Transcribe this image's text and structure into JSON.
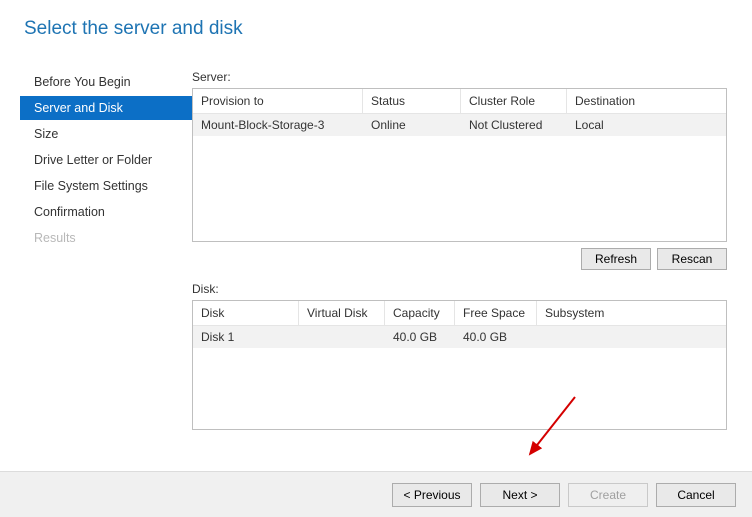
{
  "title": "Select the server and disk",
  "sidebar": {
    "items": [
      {
        "label": "Before You Begin"
      },
      {
        "label": "Server and Disk"
      },
      {
        "label": "Size"
      },
      {
        "label": "Drive Letter or Folder"
      },
      {
        "label": "File System Settings"
      },
      {
        "label": "Confirmation"
      },
      {
        "label": "Results"
      }
    ]
  },
  "server": {
    "label": "Server:",
    "headers": {
      "provision": "Provision to",
      "status": "Status",
      "cluster": "Cluster Role",
      "dest": "Destination"
    },
    "row": {
      "provision": "Mount-Block-Storage-3",
      "status": "Online",
      "cluster": "Not Clustered",
      "dest": "Local"
    }
  },
  "disk": {
    "label": "Disk:",
    "headers": {
      "disk": "Disk",
      "vdisk": "Virtual Disk",
      "capacity": "Capacity",
      "free": "Free Space",
      "sub": "Subsystem"
    },
    "row": {
      "disk": "Disk 1",
      "vdisk": "",
      "capacity": "40.0 GB",
      "free": "40.0 GB",
      "sub": ""
    }
  },
  "buttons": {
    "refresh": "Refresh",
    "rescan": "Rescan",
    "previous": "< Previous",
    "next": "Next >",
    "create": "Create",
    "cancel": "Cancel"
  }
}
